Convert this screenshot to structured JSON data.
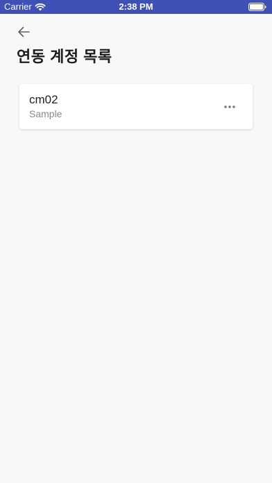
{
  "status_bar": {
    "carrier": "Carrier",
    "time": "2:38 PM",
    "icons": [
      "wifi-icon",
      "battery-icon"
    ],
    "background_color": "#3f51b5"
  },
  "header": {
    "back_icon": "arrow-left-icon",
    "title": "연동 계정 목록"
  },
  "accounts": [
    {
      "name": "cm02",
      "subtitle": "Sample",
      "menu_icon": "more-horizontal-icon"
    }
  ],
  "colors": {
    "page_background": "#f8f8f8",
    "card_background": "#ffffff",
    "title_text": "#1c1c1c",
    "secondary_text": "#8a8a8a"
  }
}
